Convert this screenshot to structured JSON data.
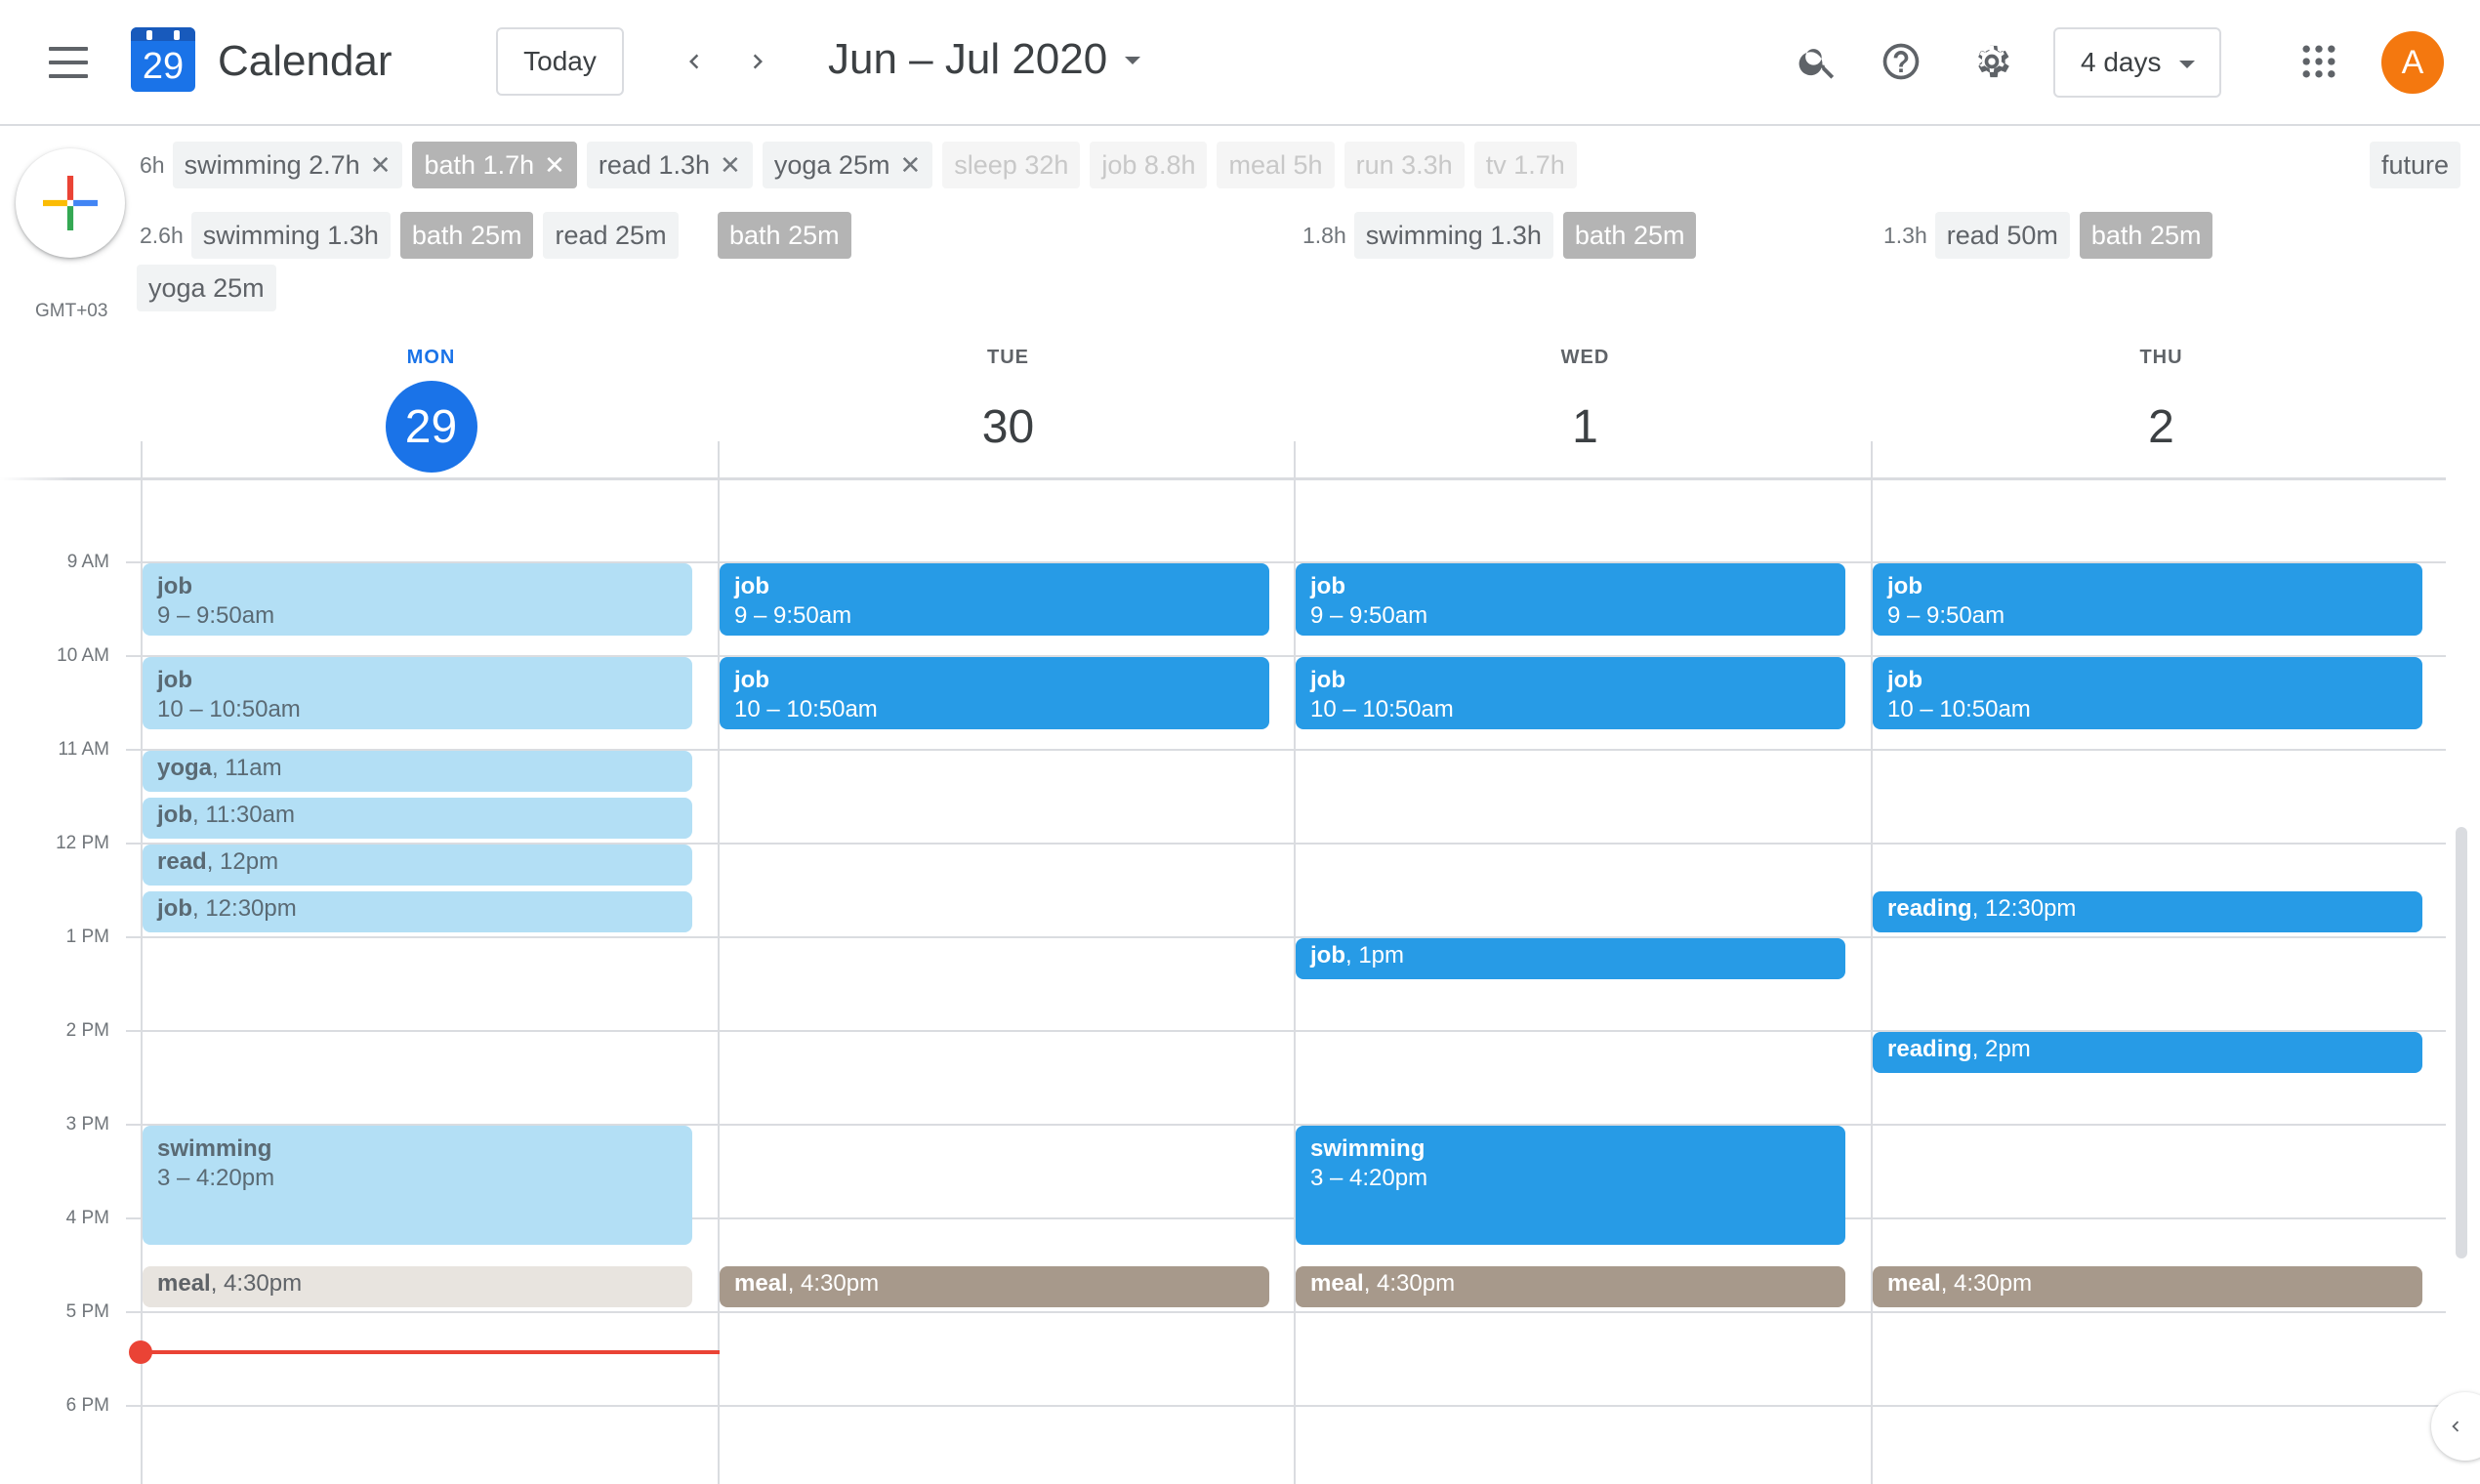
{
  "header": {
    "logo_day": "29",
    "app_title": "Calendar",
    "today_label": "Today",
    "date_range": "Jun – Jul 2020",
    "view_label": "4 days",
    "avatar_initial": "A"
  },
  "icons": {
    "menu": "hamburger-menu-icon",
    "prev": "chevron-left-icon",
    "next": "chevron-right-icon",
    "search": "search-icon",
    "help": "help-icon",
    "settings": "gear-icon",
    "apps": "apps-grid-icon",
    "create": "plus-icon"
  },
  "timezone": "GMT+03",
  "summary": {
    "range_total": "6h",
    "range_chips": [
      {
        "name": "swimming",
        "value": "2.7h",
        "removable": true
      },
      {
        "name": "bath",
        "value": "1.7h",
        "removable": true
      },
      {
        "name": "read",
        "value": "1.3h",
        "removable": true
      },
      {
        "name": "yoga",
        "value": "25m",
        "removable": true
      },
      {
        "name": "sleep",
        "value": "32h"
      },
      {
        "name": "job",
        "value": "8.8h"
      },
      {
        "name": "meal",
        "value": "5h"
      },
      {
        "name": "run",
        "value": "3.3h"
      },
      {
        "name": "tv",
        "value": "1.7h"
      }
    ],
    "future_label": "future",
    "days": [
      {
        "total": "2.6h",
        "chips": [
          {
            "name": "swimming",
            "value": "1.3h"
          },
          {
            "name": "bath",
            "value": "25m"
          },
          {
            "name": "read",
            "value": "25m"
          },
          {
            "name": "yoga",
            "value": "25m"
          }
        ]
      },
      {
        "total": "",
        "chips": [
          {
            "name": "bath",
            "value": "25m"
          }
        ]
      },
      {
        "total": "1.8h",
        "chips": [
          {
            "name": "swimming",
            "value": "1.3h"
          },
          {
            "name": "bath",
            "value": "25m"
          }
        ]
      },
      {
        "total": "1.3h",
        "chips": [
          {
            "name": "read",
            "value": "50m"
          },
          {
            "name": "bath",
            "value": "25m"
          }
        ]
      }
    ]
  },
  "days": [
    {
      "dow": "MON",
      "num": "29"
    },
    {
      "dow": "TUE",
      "num": "30"
    },
    {
      "dow": "WED",
      "num": "1"
    },
    {
      "dow": "THU",
      "num": "2"
    }
  ],
  "hours": [
    "9 AM",
    "10 AM",
    "11 AM",
    "12 PM",
    "1 PM",
    "2 PM",
    "3 PM",
    "4 PM",
    "5 PM",
    "6 PM"
  ],
  "events": {
    "mon": {
      "job1_title": "job",
      "job1_time": "9 – 9:50am",
      "job2_title": "job",
      "job2_time": "10 – 10:50am",
      "yoga_title": "yoga",
      "yoga_time": ", 11am",
      "job3_title": "job",
      "job3_time": ", 11:30am",
      "read_title": "read",
      "read_time": ", 12pm",
      "job4_title": "job",
      "job4_time": ", 12:30pm",
      "swim_title": "swimming",
      "swim_time": "3 – 4:20pm",
      "meal_title": "meal",
      "meal_time": ", 4:30pm"
    },
    "tue": {
      "job1_title": "job",
      "job1_time": "9 – 9:50am",
      "job2_title": "job",
      "job2_time": "10 – 10:50am",
      "meal_title": "meal",
      "meal_time": ", 4:30pm"
    },
    "wed": {
      "job1_title": "job",
      "job1_time": "9 – 9:50am",
      "job2_title": "job",
      "job2_time": "10 – 10:50am",
      "job3_title": "job",
      "job3_time": ", 1pm",
      "swim_title": "swimming",
      "swim_time": "3 – 4:20pm",
      "meal_title": "meal",
      "meal_time": ", 4:30pm"
    },
    "thu": {
      "job1_title": "job",
      "job1_time": "9 – 9:50am",
      "job2_title": "job",
      "job2_time": "10 – 10:50am",
      "reading1_title": "reading",
      "reading1_time": ", 12:30pm",
      "reading2_title": "reading",
      "reading2_time": ", 2pm",
      "meal_title": "meal",
      "meal_time": ", 4:30pm"
    }
  },
  "colors": {
    "accent": "#1a73e8",
    "past_event": "#b3dff5",
    "future_event": "#279be6",
    "meal_past": "#e8e4df",
    "meal_future": "#a7998b",
    "now_indicator": "#ea4335",
    "avatar": "#f4780f"
  }
}
